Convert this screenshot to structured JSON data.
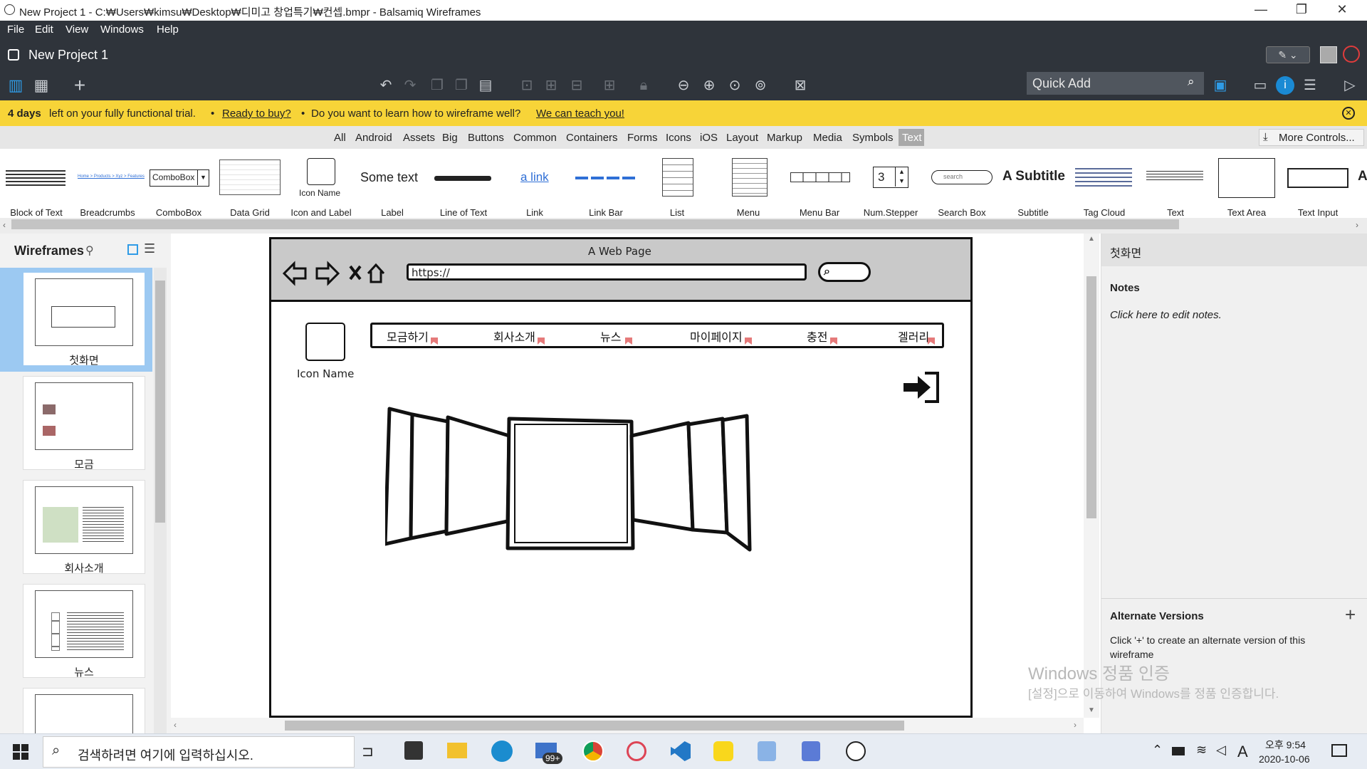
{
  "window": {
    "title": "New Project 1 - C:₩Users₩kimsu₩Desktop₩디미고 창업특기₩컨셉.bmpr - Balsamiq Wireframes",
    "minimize": "—",
    "restore": "❐",
    "close": "✕"
  },
  "menu": [
    "File",
    "Edit",
    "View",
    "Windows",
    "Help"
  ],
  "project": {
    "name": "New Project 1"
  },
  "quick_add": {
    "placeholder": "Quick Add"
  },
  "banner": {
    "days": "4 days",
    "left_text": "left on your fully functional trial.",
    "bullet": "•",
    "buy_link": "Ready to buy?",
    "question": "Do you want to learn how to wireframe well?",
    "teach_link": "We can teach you!",
    "close_icon": "close-circle-icon"
  },
  "categories": [
    "All",
    "Android",
    "Assets",
    "Big",
    "Buttons",
    "Common",
    "Containers",
    "Forms",
    "Icons",
    "iOS",
    "Layout",
    "Markup",
    "Media",
    "Symbols",
    "Text"
  ],
  "active_category": "Text",
  "more_controls": "More Controls...",
  "palette": [
    {
      "label": "Block of Text"
    },
    {
      "label": "Breadcrumbs",
      "preview": "Home > Products > Xyz > Features"
    },
    {
      "label": "ComboBox",
      "preview": "ComboBox"
    },
    {
      "label": "Data Grid"
    },
    {
      "label": "Icon and Label",
      "preview": "Icon Name"
    },
    {
      "label": "Label",
      "preview": "Some text"
    },
    {
      "label": "Line of Text"
    },
    {
      "label": "Link",
      "preview": "a link"
    },
    {
      "label": "Link Bar"
    },
    {
      "label": "List"
    },
    {
      "label": "Menu"
    },
    {
      "label": "Menu Bar"
    },
    {
      "label": "Num.Stepper",
      "preview": "3"
    },
    {
      "label": "Search Box",
      "preview": "search"
    },
    {
      "label": "Subtitle",
      "preview": "A Subtitle"
    },
    {
      "label": "Tag Cloud"
    },
    {
      "label": "Text"
    },
    {
      "label": "Text Area"
    },
    {
      "label": "Text Input"
    }
  ],
  "left_panel": {
    "title": "Wireframes",
    "pages": [
      "첫화면",
      "모금",
      "회사소개",
      "뉴스"
    ]
  },
  "wireframe": {
    "window_title": "A Web Page",
    "url": "https://",
    "icon_label": "Icon Name",
    "nav": [
      "모금하기",
      "회사소개",
      "뉴스",
      "마이페이지",
      "충전",
      "겔러리"
    ]
  },
  "right_panel": {
    "page_title": "첫화면",
    "notes_heading": "Notes",
    "notes_placeholder": "Click here to edit notes.",
    "alt_heading": "Alternate Versions",
    "alt_add": "+",
    "alt_desc": "Click '+' to create an alternate version of this wireframe"
  },
  "watermark": {
    "line1": "Windows 정품 인증",
    "line2": "[설정]으로 이동하여 Windows를 정품 인증합니다."
  },
  "taskbar": {
    "search_placeholder": "검색하려면 여기에 입력하십시오.",
    "mail_badge": "99+",
    "ime": "A",
    "time": "오후 9:54",
    "date": "2020-10-06"
  },
  "colors": {
    "dark": "#2f343b",
    "banner": "#f7d438",
    "selected_thumb": "#9cc9f2",
    "accent": "#1a8ad4"
  }
}
